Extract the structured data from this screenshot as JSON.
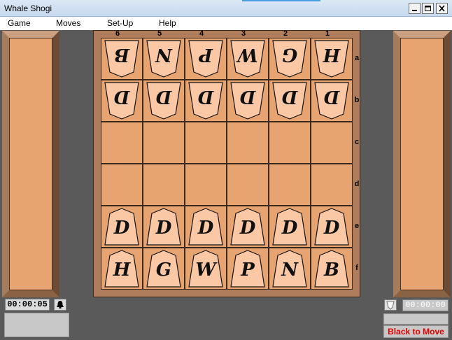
{
  "window": {
    "title": "Whale Shogi"
  },
  "menu": [
    "Game",
    "Moves",
    "Set-Up",
    "Help"
  ],
  "board": {
    "files": [
      "6",
      "5",
      "4",
      "3",
      "2",
      "1"
    ],
    "ranks": [
      "a",
      "b",
      "c",
      "d",
      "e",
      "f"
    ],
    "rows": [
      [
        {
          "g": "B",
          "side": "down"
        },
        {
          "g": "N",
          "side": "down"
        },
        {
          "g": "P",
          "side": "down"
        },
        {
          "g": "W",
          "side": "down"
        },
        {
          "g": "G",
          "side": "down"
        },
        {
          "g": "H",
          "side": "down"
        }
      ],
      [
        {
          "g": "D",
          "side": "down"
        },
        {
          "g": "D",
          "side": "down"
        },
        {
          "g": "D",
          "side": "down"
        },
        {
          "g": "D",
          "side": "down"
        },
        {
          "g": "D",
          "side": "down"
        },
        {
          "g": "D",
          "side": "down"
        }
      ],
      [
        null,
        null,
        null,
        null,
        null,
        null
      ],
      [
        null,
        null,
        null,
        null,
        null,
        null
      ],
      [
        {
          "g": "D",
          "side": "up"
        },
        {
          "g": "D",
          "side": "up"
        },
        {
          "g": "D",
          "side": "up"
        },
        {
          "g": "D",
          "side": "up"
        },
        {
          "g": "D",
          "side": "up"
        },
        {
          "g": "D",
          "side": "up"
        }
      ],
      [
        {
          "g": "H",
          "side": "up"
        },
        {
          "g": "G",
          "side": "up"
        },
        {
          "g": "W",
          "side": "up"
        },
        {
          "g": "P",
          "side": "up"
        },
        {
          "g": "N",
          "side": "up"
        },
        {
          "g": "B",
          "side": "up"
        }
      ]
    ]
  },
  "clocks": {
    "left": "00:00:05",
    "right": "00:00:00"
  },
  "status": {
    "turn": "Black to Move"
  },
  "icons": {
    "bell": "bell-icon",
    "flip": "shield-icon",
    "minimize": "minimize-icon",
    "maximize": "maximize-icon",
    "close": "close-icon"
  },
  "colors": {
    "board": "#e8a470",
    "piece": "#fbc8a6",
    "turn_text": "#e00000"
  }
}
